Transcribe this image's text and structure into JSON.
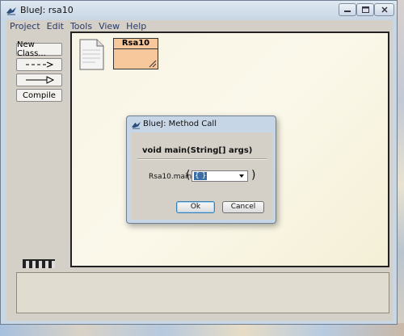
{
  "window": {
    "title": "BlueJ:  rsa10",
    "icon": "bluej-bird-icon"
  },
  "menubar": {
    "items": [
      {
        "label": "Project"
      },
      {
        "label": "Edit"
      },
      {
        "label": "Tools"
      },
      {
        "label": "View"
      },
      {
        "label": "Help"
      }
    ]
  },
  "toolbar": {
    "new_class_label": "New Class...",
    "uses_arrow_icon": "dashed-arrow-icon",
    "inherits_arrow_icon": "inheritance-arrow-icon",
    "compile_label": "Compile"
  },
  "canvas": {
    "readme_icon": "readme-document-icon",
    "class_name": "Rsa10",
    "class_color": "#f7c89c"
  },
  "dialog": {
    "title": "BlueJ:  Method Call",
    "signature": "void main(String[] args)",
    "call_label": "Rsa10.main",
    "open_paren": "(",
    "close_paren": ")",
    "arg_value": "{ }",
    "ok_label": "Ok",
    "cancel_label": "Cancel"
  },
  "colors": {
    "selection": "#3a6ea5",
    "canvas_bg": "#fbf8ea",
    "class_fill": "#f7c89c"
  }
}
